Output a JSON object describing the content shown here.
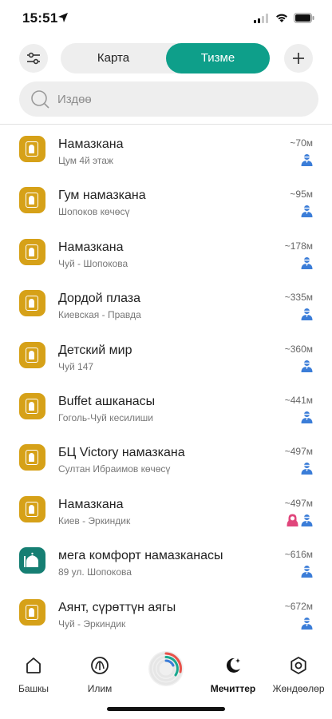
{
  "status_bar": {
    "time": "15:51"
  },
  "header": {
    "segments": {
      "map": "Карта",
      "list": "Тизме"
    },
    "active_segment": "list"
  },
  "search": {
    "placeholder": "Издөө"
  },
  "colors": {
    "accent": "#0e9f8a",
    "item_icon": "#d6a118",
    "item_icon_alt": "#167f73",
    "male": "#3b7dd8",
    "female": "#e0457b"
  },
  "mosques": [
    {
      "name": "Намазкана",
      "address": "Цум 4й этаж",
      "distance": "~70м",
      "icon": "door-icon",
      "people": [
        "male"
      ]
    },
    {
      "name": "Гум намазкана",
      "address": "Шопоков көчөсү",
      "distance": "~95м",
      "icon": "door-icon",
      "people": [
        "male"
      ]
    },
    {
      "name": "Намазкана",
      "address": "Чуй - Шопокова",
      "distance": "~178м",
      "icon": "door-icon",
      "people": [
        "male"
      ]
    },
    {
      "name": "Дордой плаза",
      "address": "Киевская - Правда",
      "distance": "~335м",
      "icon": "door-icon",
      "people": [
        "male"
      ]
    },
    {
      "name": "Детский мир",
      "address": "Чуй 147",
      "distance": "~360м",
      "icon": "door-icon",
      "people": [
        "male"
      ]
    },
    {
      "name": "Buffet ашканасы",
      "address": "Гоголь-Чуй кесилиши",
      "distance": "~441м",
      "icon": "door-icon",
      "people": [
        "male"
      ]
    },
    {
      "name": "БЦ Victory намазкана",
      "address": "Султан Ибраимов көчөсү",
      "distance": "~497м",
      "icon": "door-icon",
      "people": [
        "male"
      ]
    },
    {
      "name": "Намазкана",
      "address": "Киев - Эркиндик",
      "distance": "~497м",
      "icon": "door-icon",
      "people": [
        "female",
        "male"
      ]
    },
    {
      "name": "мега комфорт намазканасы",
      "address": "89 ул. Шопокова",
      "distance": "~616м",
      "icon": "mosque-icon",
      "people": [
        "male"
      ]
    },
    {
      "name": "Аянт, сүрөттүн аягы",
      "address": "Чуй - Эркиндик",
      "distance": "~672м",
      "icon": "door-icon",
      "people": [
        "male"
      ]
    }
  ],
  "tabs": [
    {
      "label": "Башкы",
      "icon": "home-icon"
    },
    {
      "label": "Илим",
      "icon": "book-icon"
    },
    {
      "label": "Мечиттер",
      "icon": "moon-star-icon",
      "active": true
    },
    {
      "label": "Жөндөөлөр",
      "icon": "settings-icon"
    }
  ]
}
